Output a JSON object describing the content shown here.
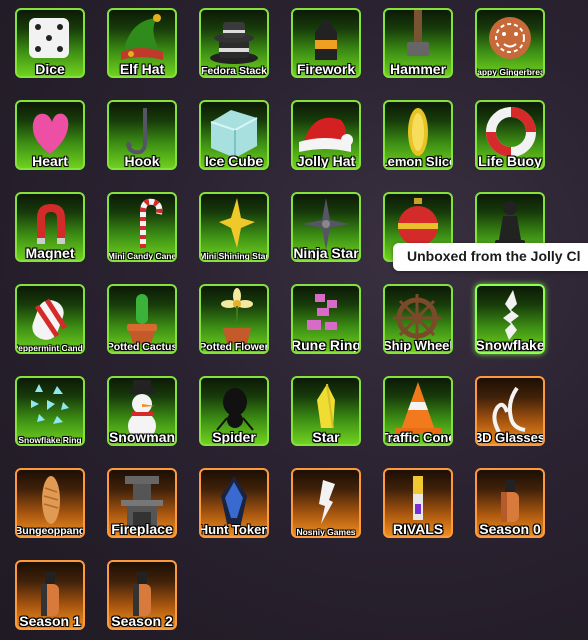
{
  "tooltip": {
    "text": "Unboxed from the Jolly Cl"
  },
  "items": [
    {
      "label": "Dice",
      "rarity": "common",
      "icon": "dice-icon",
      "size": "l"
    },
    {
      "label": "Elf Hat",
      "rarity": "common",
      "icon": "elf-hat-icon",
      "size": "l"
    },
    {
      "label": "Fedora Stack",
      "rarity": "common",
      "icon": "fedora-stack-icon",
      "size": "s"
    },
    {
      "label": "Firework",
      "rarity": "common",
      "icon": "firework-icon",
      "size": "l"
    },
    {
      "label": "Hammer",
      "rarity": "common",
      "icon": "hammer-icon",
      "size": "l"
    },
    {
      "label": "Happy Gingerbread",
      "rarity": "common",
      "icon": "gingerbread-icon",
      "size": "xs"
    },
    {
      "label": "Heart",
      "rarity": "common",
      "icon": "heart-icon",
      "size": "l"
    },
    {
      "label": "Hook",
      "rarity": "common",
      "icon": "hook-icon",
      "size": "l"
    },
    {
      "label": "Ice Cube",
      "rarity": "common",
      "icon": "ice-cube-icon",
      "size": "l"
    },
    {
      "label": "Jolly Hat",
      "rarity": "common",
      "icon": "santa-hat-icon",
      "size": "l"
    },
    {
      "label": "Lemon Slice",
      "rarity": "common",
      "icon": "lemon-slice-icon",
      "size": "m"
    },
    {
      "label": "Life Buoy",
      "rarity": "common",
      "icon": "life-buoy-icon",
      "size": "l"
    },
    {
      "label": "Magnet",
      "rarity": "common",
      "icon": "magnet-icon",
      "size": "l"
    },
    {
      "label": "Mini Candy Cane",
      "rarity": "common",
      "icon": "candy-cane-icon",
      "size": "xs"
    },
    {
      "label": "Mini Shining Star",
      "rarity": "common",
      "icon": "shining-star-icon",
      "size": "xs"
    },
    {
      "label": "Ninja Star",
      "rarity": "common",
      "icon": "ninja-star-icon",
      "size": "l"
    },
    {
      "label": "O",
      "rarity": "common",
      "icon": "ornament-icon",
      "size": "l"
    },
    {
      "label": "",
      "rarity": "common",
      "icon": "pawn-icon",
      "size": "l"
    },
    {
      "label": "Peppermint Candy",
      "rarity": "common",
      "icon": "peppermint-icon",
      "size": "xs"
    },
    {
      "label": "Potted Cactus",
      "rarity": "common",
      "icon": "cactus-icon",
      "size": "s"
    },
    {
      "label": "Potted Flower",
      "rarity": "common",
      "icon": "flower-icon",
      "size": "s"
    },
    {
      "label": "Rune Ring",
      "rarity": "common",
      "icon": "rune-ring-icon",
      "size": "l"
    },
    {
      "label": "Ship Wheel",
      "rarity": "common",
      "icon": "ship-wheel-icon",
      "size": "m"
    },
    {
      "label": "Snowflake",
      "rarity": "common",
      "icon": "snowflake-icon",
      "size": "l",
      "selected": true
    },
    {
      "label": "Snowflake Ring",
      "rarity": "common",
      "icon": "snowflake-ring-icon",
      "size": "xs"
    },
    {
      "label": "Snowman",
      "rarity": "common",
      "icon": "snowman-icon",
      "size": "l"
    },
    {
      "label": "Spider",
      "rarity": "common",
      "icon": "spider-icon",
      "size": "l"
    },
    {
      "label": "Star",
      "rarity": "common",
      "icon": "star-icon",
      "size": "l"
    },
    {
      "label": "Traffic Cone",
      "rarity": "common",
      "icon": "traffic-cone-icon",
      "size": "m"
    },
    {
      "label": "3D Glasses",
      "rarity": "rare",
      "icon": "3d-glasses-icon",
      "size": "m"
    },
    {
      "label": "Bungeoppang",
      "rarity": "rare",
      "icon": "bungeoppang-icon",
      "size": "s"
    },
    {
      "label": "Fireplace",
      "rarity": "rare",
      "icon": "fireplace-icon",
      "size": "l"
    },
    {
      "label": "Hunt Token",
      "rarity": "rare",
      "icon": "hunt-token-icon",
      "size": "m"
    },
    {
      "label": "Nosniy Games",
      "rarity": "rare",
      "icon": "nosniy-icon",
      "size": "xs"
    },
    {
      "label": "RIVALS",
      "rarity": "rare",
      "icon": "rivals-icon",
      "size": "l"
    },
    {
      "label": "Season 0",
      "rarity": "rare",
      "icon": "season-0-icon",
      "size": "l"
    },
    {
      "label": "Season 1",
      "rarity": "rare",
      "icon": "season-1-icon",
      "size": "l"
    },
    {
      "label": "Season 2",
      "rarity": "rare",
      "icon": "season-2-icon",
      "size": "l"
    }
  ]
}
